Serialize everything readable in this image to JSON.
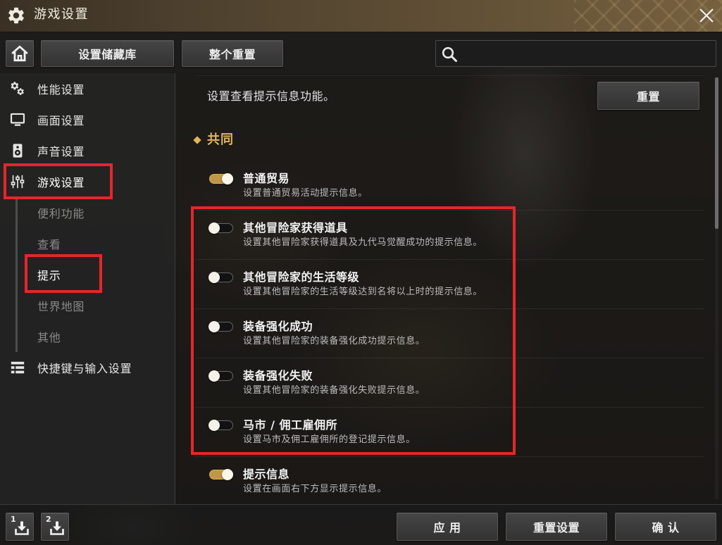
{
  "window": {
    "title": "游戏设置",
    "title_icon": "gear-icon",
    "close_icon": "close-icon"
  },
  "toolbar": {
    "home_icon": "home-icon",
    "preset_storage_label": "设置储藏库",
    "reset_all_label": "整个重置",
    "search": {
      "icon": "search-icon",
      "value": ""
    }
  },
  "sidebar": {
    "categories": [
      {
        "label": "性能设置",
        "icon": "cogs-icon",
        "selected": false
      },
      {
        "label": "画面设置",
        "icon": "monitor-icon",
        "selected": false
      },
      {
        "label": "声音设置",
        "icon": "speaker-icon",
        "selected": false
      },
      {
        "label": "游戏设置",
        "icon": "sliders-icon",
        "selected": true
      },
      {
        "label": "快捷键与输入设置",
        "icon": "shortcut-list-icon",
        "selected": false
      }
    ],
    "game_settings_subitems": [
      {
        "label": "便利功能",
        "selected": false
      },
      {
        "label": "查看",
        "selected": false
      },
      {
        "label": "提示",
        "selected": true
      },
      {
        "label": "世界地图",
        "selected": false
      },
      {
        "label": "其他",
        "selected": false
      }
    ]
  },
  "content": {
    "description": "设置查看提示信息功能。",
    "reset_label": "重置",
    "section_icon": "diamond-bullet-icon",
    "section_title": "共同",
    "options": [
      {
        "title": "普通贸易",
        "description": "设置普通贸易活动提示信息。",
        "enabled": true
      },
      {
        "title": "其他冒险家获得道具",
        "description": "设置其他冒险家获得道具及九代马觉醒成功的提示信息。",
        "enabled": false
      },
      {
        "title": "其他冒险家的生活等级",
        "description": "设置其他冒险家的生活等级达到名将以上时的提示信息。",
        "enabled": false
      },
      {
        "title": "装备强化成功",
        "description": "设置其他冒险家的装备强化成功提示信息。",
        "enabled": false
      },
      {
        "title": "装备强化失败",
        "description": "设置其他冒险家的装备强化失败提示信息。",
        "enabled": false
      },
      {
        "title": "马市 / 佣工雇佣所",
        "description": "设置马市及佣工雇佣所的登记提示信息。",
        "enabled": false
      },
      {
        "title": "提示信息",
        "description": "设置在画面右下方显示提示信息。",
        "enabled": true
      }
    ]
  },
  "footer": {
    "save_slots": [
      {
        "number": "1",
        "icon": "download-icon"
      },
      {
        "number": "2",
        "icon": "download-icon"
      }
    ],
    "apply_label": "应 用",
    "reset_settings_label": "重置设置",
    "confirm_label": "确 认"
  },
  "theme": {
    "title_bar": "#5a4a32",
    "panel": "#222222",
    "accent_gold": "#e2b65a",
    "toggle_on": "#c29647",
    "text": "#eeeeee",
    "muted_text": "#8a8a8a",
    "annotation_red": "#e5262b"
  }
}
